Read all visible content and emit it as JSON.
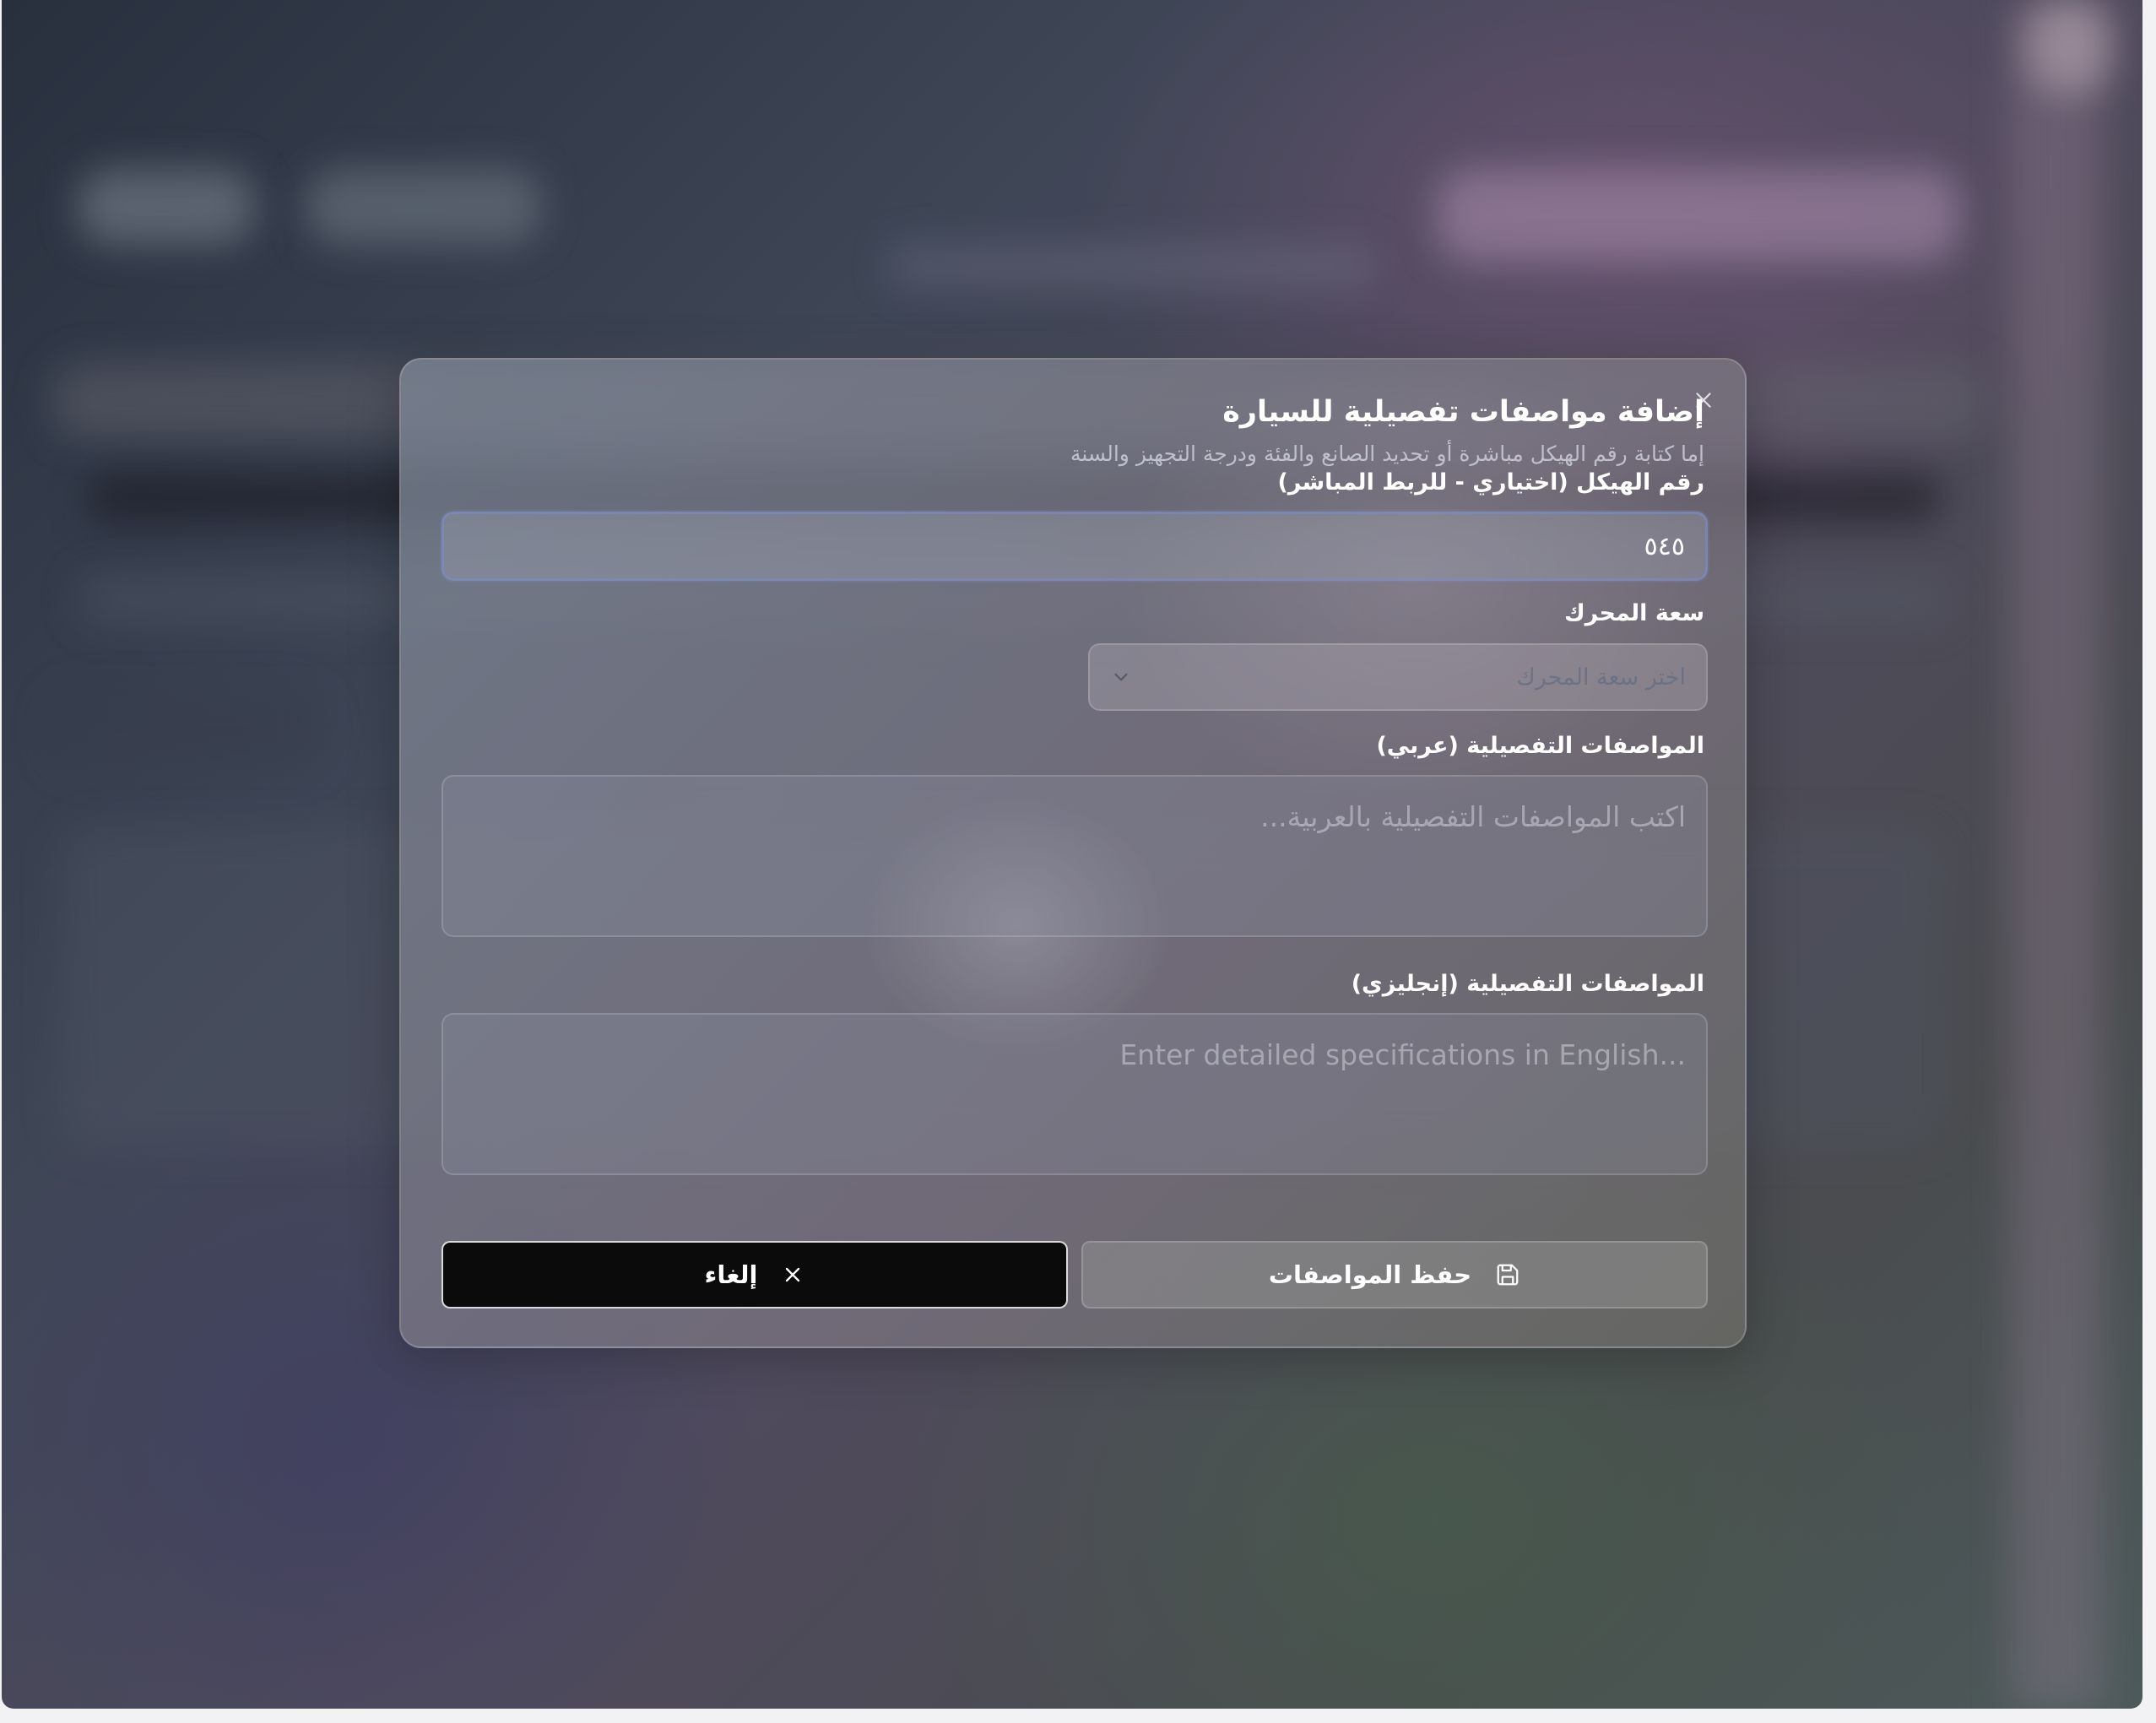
{
  "dialog": {
    "title": "إضافة مواصفات تفصيلية للسيارة",
    "subtitle": "إما كتابة رقم الهيكل مباشرة أو تحديد الصانع والفئة ودرجة التجهيز والسنة",
    "close_icon": "close-icon",
    "vin": {
      "label": "رقم الهيكل (اختياري - للربط المباشر)",
      "value": "٥٤٥"
    },
    "engine": {
      "label": "سعة المحرك",
      "placeholder": "اختر سعة المحرك",
      "icon": "chevron-down-icon"
    },
    "specs_ar": {
      "label": "المواصفات التفصيلية (عربي)",
      "placeholder": "اكتب المواصفات التفصيلية بالعربية..."
    },
    "specs_en": {
      "label": "المواصفات التفصيلية (إنجليزي)",
      "placeholder": "...Enter detailed specifications in English"
    },
    "buttons": {
      "save_label": "حفظ المواصفات",
      "save_icon": "save-icon",
      "cancel_label": "إلغاء",
      "cancel_icon": "close-icon"
    }
  }
}
